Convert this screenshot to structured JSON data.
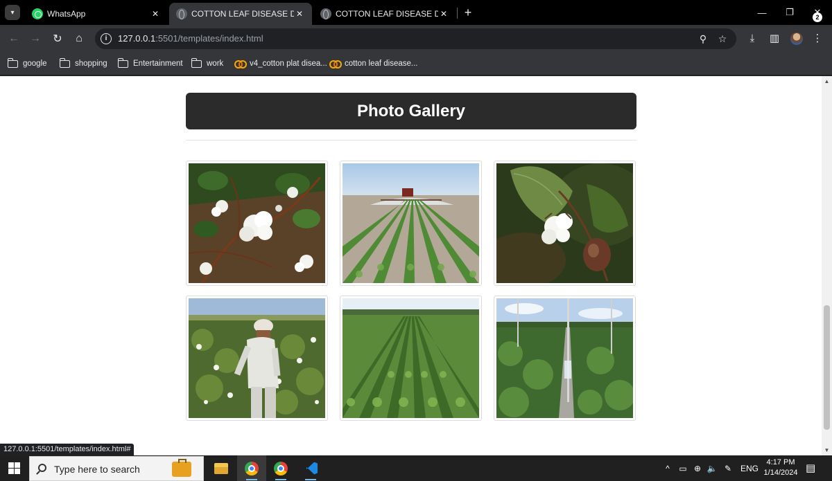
{
  "browser": {
    "tabs": [
      {
        "title": "WhatsApp",
        "icon": "whatsapp-icon",
        "active": false
      },
      {
        "title": "COTTON LEAF DISEASE DETECT",
        "icon": "globe-icon",
        "active": true
      },
      {
        "title": "COTTON LEAF DISEASE DETECT",
        "icon": "globe-icon",
        "active": false
      }
    ],
    "address": {
      "host": "127.0.0.1",
      "path": ":5501/templates/index.html"
    },
    "bookmarks": [
      {
        "label": "google",
        "icon": "folder-icon"
      },
      {
        "label": "shopping",
        "icon": "folder-icon"
      },
      {
        "label": "Entertainment",
        "icon": "folder-icon"
      },
      {
        "label": "work",
        "icon": "folder-icon"
      },
      {
        "label": "v4_cotton plat disea...",
        "icon": "colab-icon"
      },
      {
        "label": "cotton leaf disease...",
        "icon": "colab-icon"
      }
    ],
    "status_url": "127.0.0.1:5501/templates/index.html#"
  },
  "page": {
    "heading": "Photo Gallery",
    "photos": [
      {
        "alt": "Open cotton bolls on plant",
        "icon": "cotton-boll-photo"
      },
      {
        "alt": "Tractor spraying cotton field rows",
        "icon": "tractor-spray-photo"
      },
      {
        "alt": "Single cotton boll with leaf",
        "icon": "cotton-closeup-photo"
      },
      {
        "alt": "Farmer picking cotton",
        "icon": "farmer-photo"
      },
      {
        "alt": "Green cotton crop rows",
        "icon": "crop-rows-photo"
      },
      {
        "alt": "Irrigated cotton field",
        "icon": "irrigation-photo"
      }
    ]
  },
  "taskbar": {
    "search_placeholder": "Type here to search",
    "language": "ENG",
    "time": "4:17 PM",
    "date": "1/14/2024",
    "notification_count": "2"
  },
  "colors": {
    "header_bg": "#2b2b2b",
    "page_bg": "#ffffff",
    "chrome_dark": "#35363a"
  }
}
